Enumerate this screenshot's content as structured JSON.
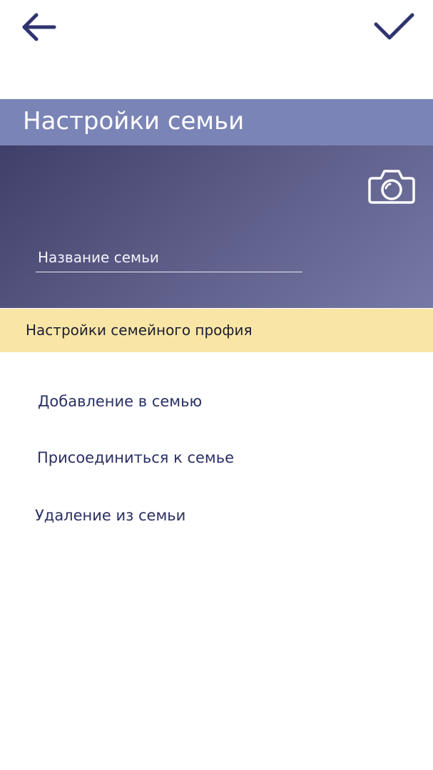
{
  "header": {
    "back_icon": "arrow-left-icon",
    "confirm_icon": "checkmark-icon",
    "icon_color": "#2f3470"
  },
  "page_title": "Настройки семьи",
  "hero": {
    "camera_icon": "camera-icon",
    "family_name_placeholder": "Название семьи",
    "family_name_value": ""
  },
  "profile_banner": {
    "label": "Настройки семейного профия",
    "color": "#f9e6a6"
  },
  "menu": {
    "items": [
      {
        "label": "Добавление в семью"
      },
      {
        "label": "Присоединиться к семье"
      },
      {
        "label": "Удаление из семьи"
      }
    ]
  },
  "colors": {
    "title_bar": "#7b84b6",
    "hero_start": "#3f3f69",
    "hero_end": "#7679a6",
    "menu_text": "#2a2f63"
  }
}
